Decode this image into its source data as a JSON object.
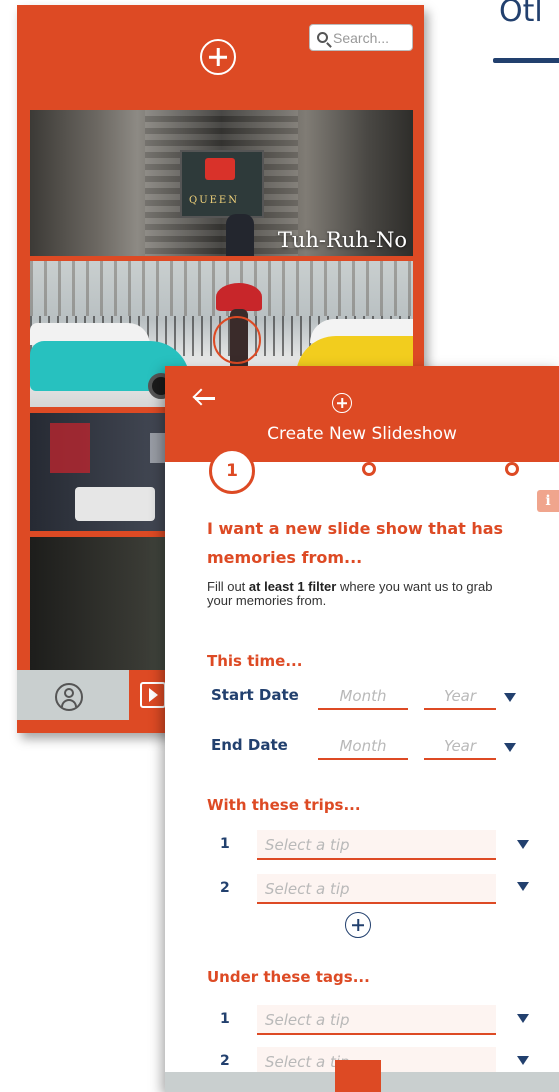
{
  "heading": {
    "fragment": "Otl"
  },
  "back_screen": {
    "search": {
      "placeholder": "Search..."
    },
    "slideshows": [
      {
        "caption": "Tuh-Ruh-No",
        "sign_text": "QUEEN"
      },
      {
        "caption": ""
      },
      {
        "caption": ""
      },
      {
        "caption": ""
      }
    ],
    "tabbar": {
      "items": [
        "profile-icon",
        "play-icon"
      ]
    }
  },
  "front_screen": {
    "title": "Create New Slideshow",
    "steps": {
      "current": "1",
      "total": 3
    },
    "intro": {
      "heading": "I want a new slide show that has memories from...",
      "body_prefix": "Fill out ",
      "body_bold": "at least 1 filter",
      "body_suffix": " where you want us to grab your memories from."
    },
    "time_section": {
      "title": "This time...",
      "start_label": "Start Date",
      "end_label": "End Date",
      "month_placeholder": "Month",
      "year_placeholder": "Year"
    },
    "trips_section": {
      "title": "With these trips...",
      "rows": [
        {
          "num": "1",
          "placeholder": "Select a tip"
        },
        {
          "num": "2",
          "placeholder": "Select a tip"
        }
      ]
    },
    "tags_section": {
      "title": "Under these tags...",
      "rows": [
        {
          "num": "1",
          "placeholder": "Select a tip"
        },
        {
          "num": "2",
          "placeholder": "Select a tip"
        }
      ]
    },
    "info_badge": "i"
  },
  "colors": {
    "accent": "#dd4a24",
    "navy": "#22406e",
    "tabbar": "#c9cfcf"
  }
}
